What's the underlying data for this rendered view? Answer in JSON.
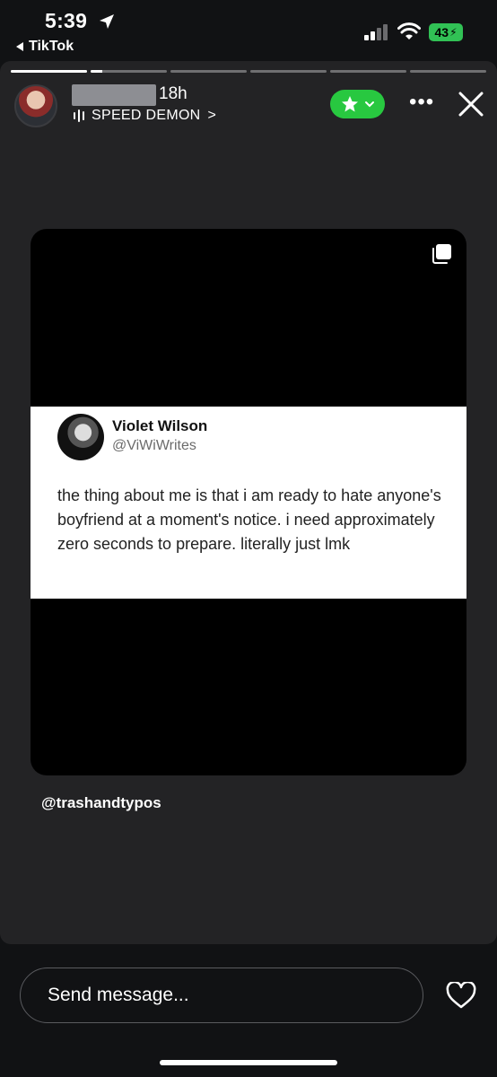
{
  "status_bar": {
    "time": "5:39",
    "back_app": "TikTok",
    "battery": "43"
  },
  "story": {
    "progress": {
      "segments": 6,
      "current_index": 1,
      "current_fraction": 0.15
    },
    "header": {
      "age": "18h",
      "music_label": "SPEED DEMON",
      "music_chevron": ">",
      "more_label": "•••"
    },
    "post": {
      "author_name": "Violet Wilson",
      "author_handle": "@ViWiWrites",
      "text": "the thing about me is that i am ready to hate anyone's boyfriend at a moment's notice. i need approximately zero seconds to prepare. literally just lmk"
    },
    "caption": "@trashandtypos"
  },
  "reply_bar": {
    "placeholder": "Send message..."
  },
  "colors": {
    "background": "#111214",
    "story_bg": "#232325",
    "close_friends_green": "#28c840",
    "battery_green": "#31c155"
  }
}
